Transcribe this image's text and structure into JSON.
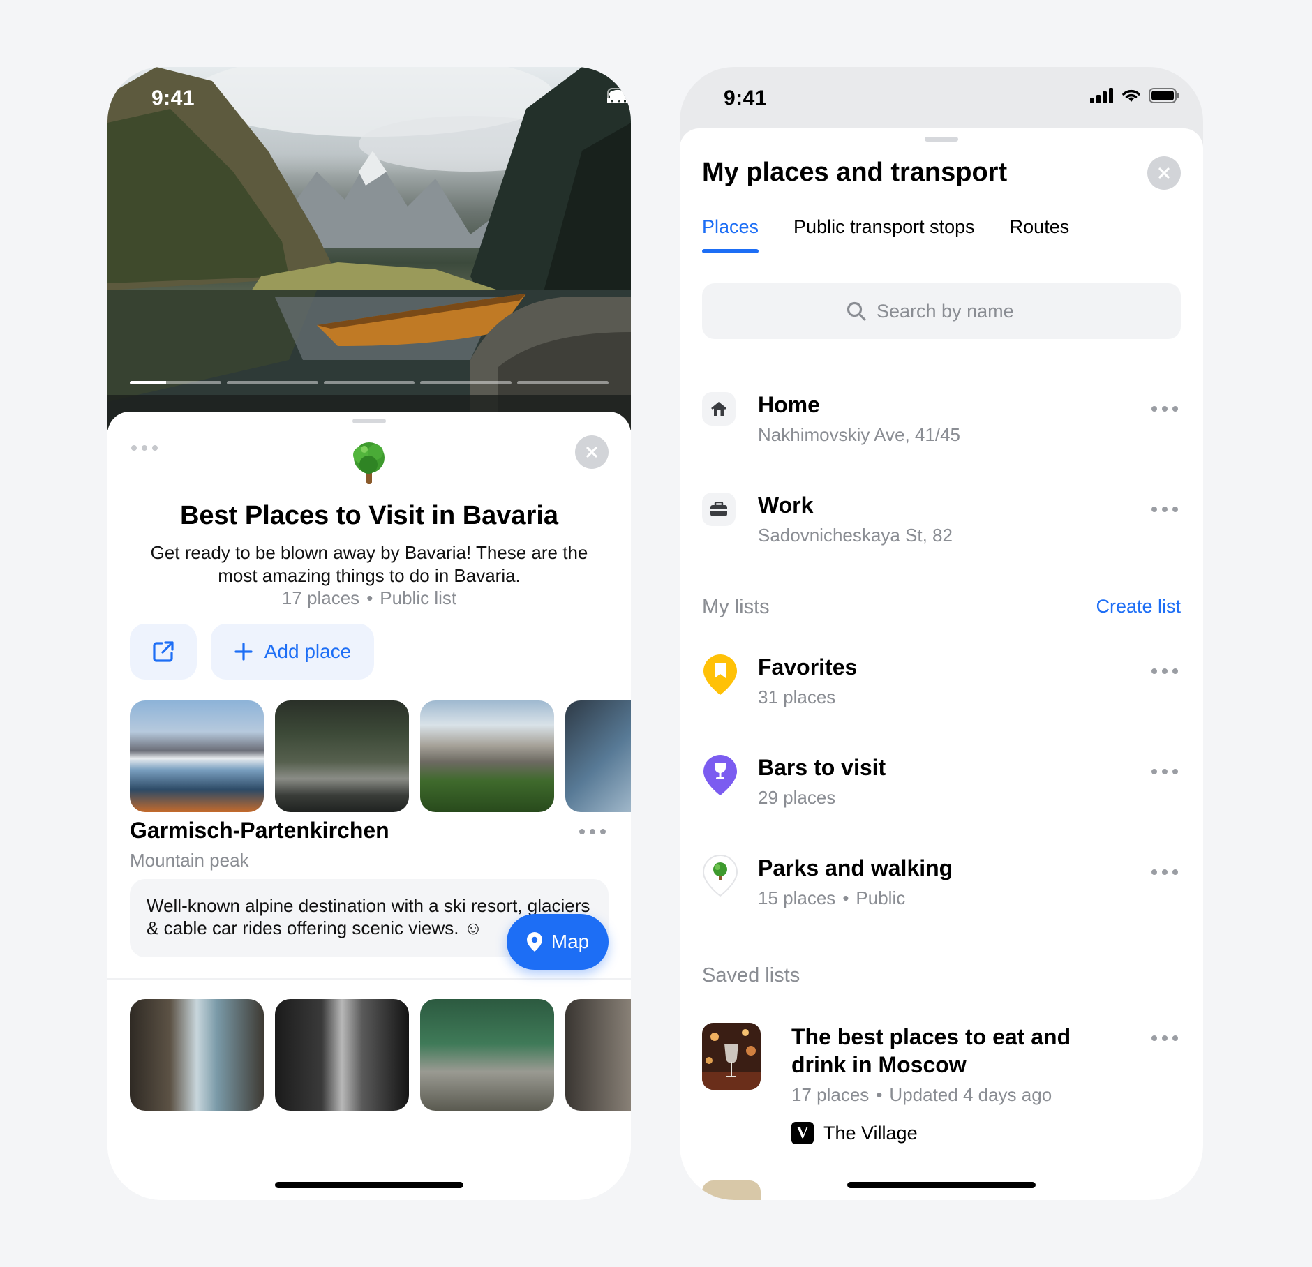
{
  "left_phone": {
    "status": {
      "time": "9:41"
    },
    "story_progress": {
      "segments": 5,
      "active_index": 0,
      "active_fill": 0.4
    },
    "list": {
      "title": "Best Places to Visit in Bavaria",
      "description": "Get ready to be blown away by Bavaria! These are the most amazing things to do in Bavaria.",
      "count": "17 places",
      "visibility": "Public list",
      "separator": "•"
    },
    "actions": {
      "add_place_label": "Add place"
    },
    "place": {
      "title": "Garmisch-Partenkirchen",
      "type": "Mountain peak",
      "description": "Well-known alpine destination with a ski resort, glaciers & cable car rides offering scenic views. ☺"
    },
    "map_button_label": "Map"
  },
  "right_phone": {
    "status": {
      "time": "9:41"
    },
    "title": "My places and transport",
    "tabs": [
      {
        "label": "Places",
        "active": true
      },
      {
        "label": "Public transport stops",
        "active": false
      },
      {
        "label": "Routes",
        "active": false
      }
    ],
    "search": {
      "placeholder": "Search by name"
    },
    "fixed_places": [
      {
        "name": "Home",
        "address": "Nakhimovskiy Ave, 41/45",
        "icon": "home-icon"
      },
      {
        "name": "Work",
        "address": "Sadovnicheskaya St, 82",
        "icon": "briefcase-icon"
      }
    ],
    "my_lists_label": "My lists",
    "create_list_label": "Create list",
    "my_lists": [
      {
        "name": "Favorites",
        "meta": "31 places",
        "color": "#ffc107",
        "icon": "bookmark-pin-icon"
      },
      {
        "name": "Bars to visit",
        "meta": "29 places",
        "color": "#7b5cf0",
        "icon": "wine-glass-pin-icon"
      },
      {
        "name": "Parks and walking",
        "meta": "15 places",
        "public": "Public",
        "color": "#ffffff",
        "icon": "tree-pin-icon"
      }
    ],
    "saved_lists_label": "Saved lists",
    "saved_lists": [
      {
        "name": "The best places to eat and drink in Moscow",
        "count": "17 places",
        "updated": "Updated 4 days ago",
        "author": "The Village",
        "author_logo": "V"
      }
    ],
    "separator": "•"
  }
}
